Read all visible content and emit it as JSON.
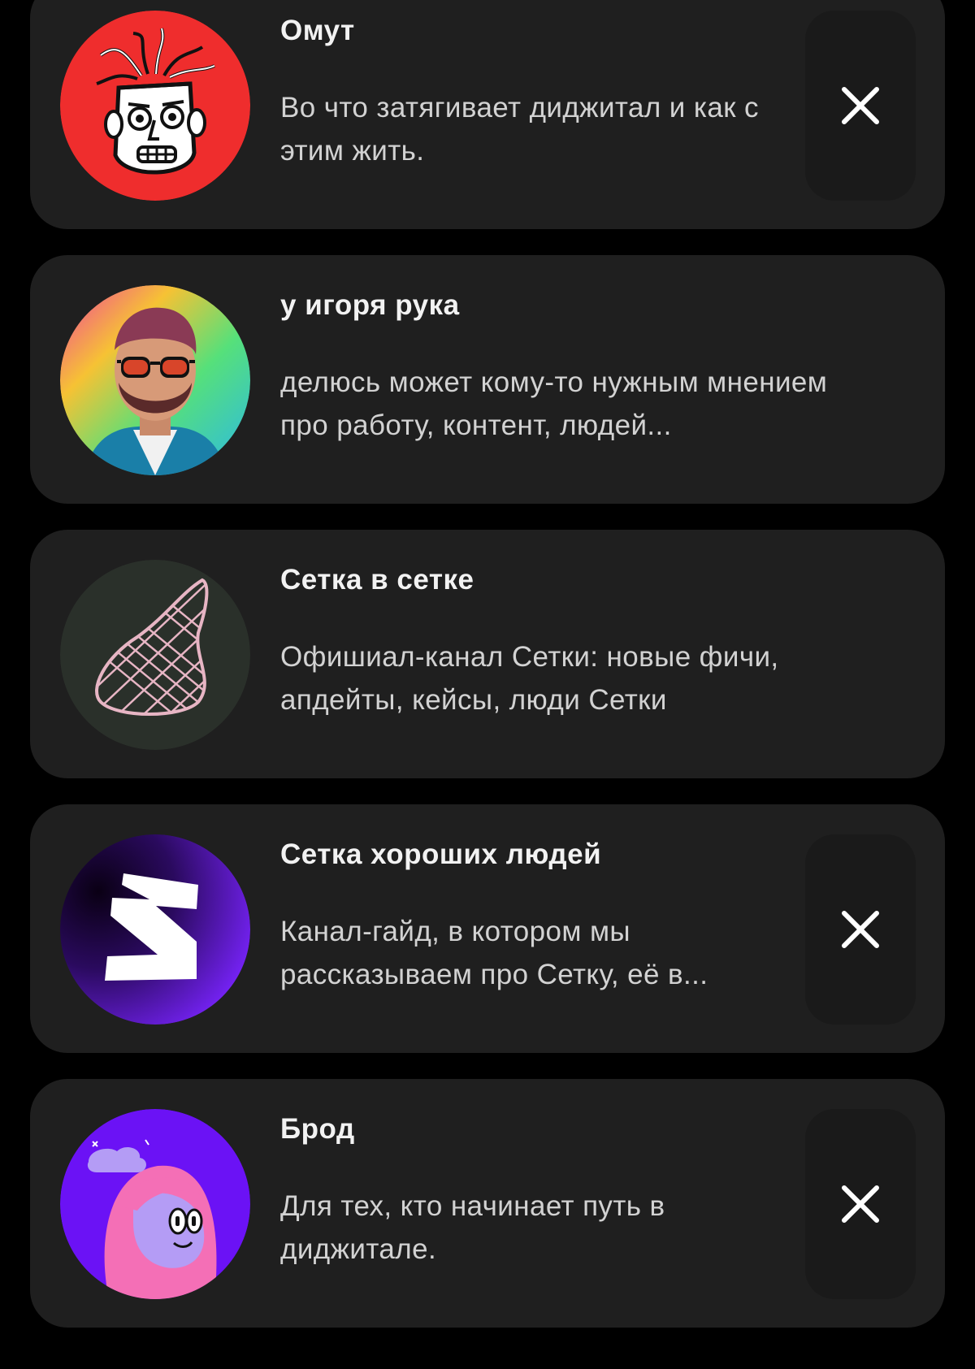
{
  "channels": [
    {
      "title": "Омут",
      "description": "Во что затягивает диджитал и как с этим жить.",
      "avatar_icon": "omut-avatar-icon",
      "avatar_color": "#ef2d2d",
      "has_close": true
    },
    {
      "title": "у игоря рука",
      "description": "делюсь может кому-то нужным мнением про работу, контент, людей...",
      "avatar_icon": "igor-avatar-icon",
      "avatar_color": "#3fd1c0",
      "has_close": false
    },
    {
      "title": "Сетка в сетке",
      "description": "Офишиал-канал Сетки: новые фичи, апдейты, кейсы, люди Сетки",
      "avatar_icon": "string-bag-avatar-icon",
      "avatar_color": "#2a302a",
      "has_close": false
    },
    {
      "title": "Сетка хороших людей",
      "description": "Канал-гайд, в котором мы рассказываем про Сетку, её в...",
      "avatar_icon": "setka-logo-avatar-icon",
      "avatar_color": "#6a1ef0",
      "has_close": true
    },
    {
      "title": "Брод",
      "description": "Для тех, кто начинает путь в диджитале.",
      "avatar_icon": "brod-avatar-icon",
      "avatar_color": "#6b12f5",
      "has_close": true
    }
  ],
  "close_icon": "close-icon",
  "colors": {
    "background": "#000000",
    "card": "#1f1f1f",
    "close_button": "#1a1a1a",
    "title_text": "#f2f2f2",
    "description_text": "#d2d2d2"
  }
}
